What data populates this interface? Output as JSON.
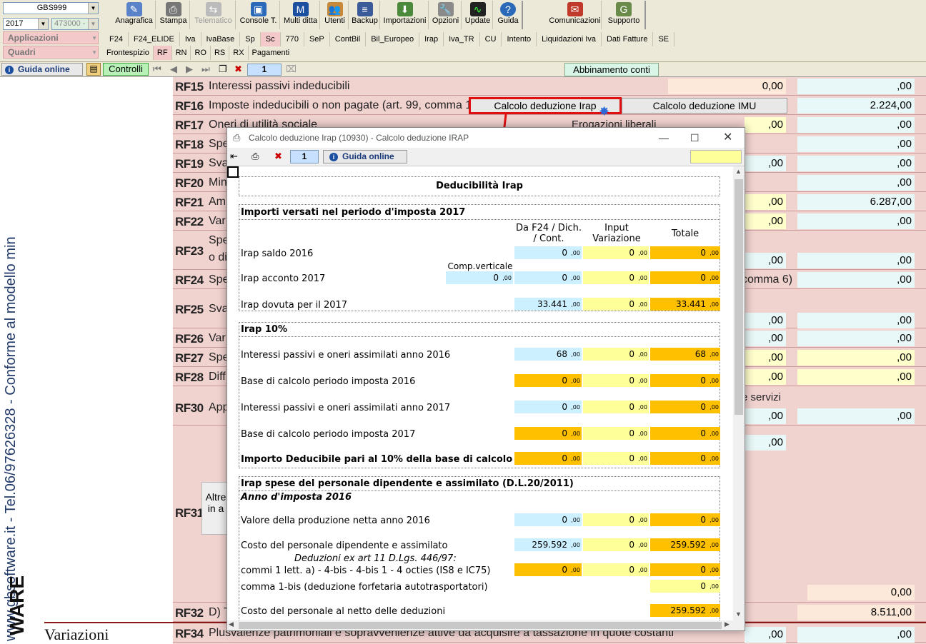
{
  "toolbar": {
    "company": "GBS999",
    "year": "2017",
    "code": "473000 -",
    "applicazioni": "Applicazioni",
    "quadri": "Quadri",
    "buttons": [
      "Anagrafica",
      "Stampa",
      "Telematico",
      "Console T.",
      "Multi ditta",
      "Utenti",
      "Backup",
      "Importazioni",
      "Opzioni",
      "Update",
      "Guida",
      "Comunicazioni",
      "Supporto"
    ],
    "tabs1": [
      "F24",
      "F24_ELIDE",
      "Iva",
      "IvaBase",
      "Sp",
      "Sc",
      "770",
      "SeP",
      "ContBil",
      "Bil_Europeo",
      "Irap",
      "Iva_TR",
      "CU",
      "Intento",
      "Liquidazioni Iva",
      "Dati Fatture",
      "SE"
    ],
    "tabs2": [
      "Frontespizio",
      "RF",
      "RN",
      "RO",
      "RS",
      "RX",
      "Pagamenti"
    ]
  },
  "nav": {
    "guida": "Guida online",
    "controlli": "Controlli",
    "page": "1",
    "abbinamento": "Abbinamento conti"
  },
  "banner": {
    "text": "www.gbsoftware.it - Tel.06/97626328 - Conforme al modello min",
    "ware": "WARE"
  },
  "form": {
    "rows": [
      {
        "code": "RF15",
        "desc": "Interessi passivi indeducibili",
        "v1": "0,00",
        "v2": ",00"
      },
      {
        "code": "RF16",
        "desc": "Imposte indeducibili o non pagate (art. 99, comma 1)",
        "v2": "2.224,00"
      },
      {
        "code": "RF17",
        "desc": "Oneri di utilità sociale",
        "v1": ",00",
        "v2": ",00"
      },
      {
        "code": "RF18",
        "desc": "Spe",
        "v2": ",00"
      },
      {
        "code": "RF19",
        "desc": "Sva",
        "v1": ",00",
        "v2": ",00"
      },
      {
        "code": "RF20",
        "desc": "Min",
        "v2": ",00"
      },
      {
        "code": "RF21",
        "desc": "Am",
        "v1": ",00",
        "v2": "6.287,00"
      },
      {
        "code": "RF22",
        "desc": "Var",
        "v1": ",00",
        "v2": ",00"
      },
      {
        "code": "RF23",
        "desc": "Spe",
        "v1": ",00",
        "v2": ",00"
      },
      {
        "code": "RF24",
        "desc": "Spe",
        "v2": ",00"
      },
      {
        "code": "RF25",
        "desc": "Sva",
        "v1": ",00",
        "v2": ",00"
      },
      {
        "code": "RF26",
        "desc": "Var",
        "v1": ",00",
        "v2": ",00"
      },
      {
        "code": "RF27",
        "desc": "Spe",
        "v1": ",00",
        "v2": ",00"
      },
      {
        "code": "RF28",
        "desc": "Diff",
        "v1": ",00",
        "v2": ",00"
      },
      {
        "code": "RF30",
        "desc": "App",
        "v1": ",00",
        "v2": ",00"
      },
      {
        "code": "RF31",
        "desc": "",
        "v1": ",00",
        "v2": ""
      },
      {
        "code": "RF32",
        "desc": "D) T",
        "v1": ",00",
        "v2": "8.511,00"
      },
      {
        "code": "RF34",
        "desc": "Plusvalenze patrimoniali e sopravvenienze attive da acquisire a tassazione in quote costanti",
        "v1": ",00",
        "v2": ",00"
      }
    ],
    "erogazioni": "Erogazioni liberali",
    "rf23b": "o di",
    "comma6": "comma 6)",
    "servizi": "e servizi",
    "altre": "Altre",
    "ina": "in a",
    "v55": "0,00",
    "variazioni": "Variazioni"
  },
  "buttons": {
    "irap": "Calcolo deduzione Irap",
    "imu": "Calcolo deduzione IMU"
  },
  "dialog": {
    "title": "Calcolo deduzione Irap (10930) - Calcolo deduzione IRAP",
    "page": "1",
    "guida": "Guida online",
    "heading": "Deducibilità Irap",
    "s1": {
      "title": "Importi versati nel periodo d'imposta 2017",
      "h1": "Da F24 / Dich. / Cont.",
      "h2": "Input Variazione",
      "h3": "Totale",
      "compvert": "Comp.verticale",
      "rows": [
        {
          "label": "Irap saldo 2016",
          "a": "0",
          "b": "0",
          "c": "0"
        },
        {
          "label": "Irap acconto 2017",
          "comp": "0",
          "a": "0",
          "b": "0",
          "c": "0"
        },
        {
          "label": "Irap dovuta per il 2017",
          "a": "33.441",
          "b": "0",
          "c": "33.441"
        }
      ]
    },
    "s2": {
      "title": "Irap 10%",
      "rows": [
        {
          "label": "Interessi passivi e oneri assimilati anno 2016",
          "a": "68",
          "b": "0",
          "c": "68"
        },
        {
          "label": "Base di calcolo periodo imposta 2016",
          "a": "0",
          "b": "0",
          "c": "0"
        },
        {
          "label": "Interessi passivi e oneri assimilati anno 2017",
          "a": "0",
          "b": "0",
          "c": "0"
        },
        {
          "label": "Base di calcolo periodo imposta 2017",
          "a": "0",
          "b": "0",
          "c": "0"
        },
        {
          "label": "Importo Deducibile pari al 10% della base di calcolo",
          "a": "0",
          "b": "0",
          "c": "0"
        }
      ]
    },
    "s3": {
      "title": "Irap spese del personale dipendente e assimilato (D.L.20/2011)",
      "sub": "Anno d'imposta 2016",
      "rows": [
        {
          "label": "Valore della produzione netta anno 2016",
          "a": "0",
          "b": "0",
          "c": "0"
        },
        {
          "label": "Costo del personale dipendente e assimilato",
          "a": "259.592",
          "b": "0",
          "c": "259.592"
        },
        {
          "label": "commi 1 lett. a) - 4-bis - 4-bis 1 - 4 octies (IS8 e IC75)",
          "a": "0",
          "b": "0",
          "c": "0"
        },
        {
          "label": "comma 1-bis (deduzione forfetaria autotrasportatori)",
          "c": "0"
        },
        {
          "label": "Costo del personale al netto delle deduzioni",
          "c": "259.592"
        }
      ],
      "deduz": "Deduzioni ex art 11 D.Lgs. 446/97:"
    },
    "dec": ",00"
  },
  "colors": {
    "pink": "#f0d2cf",
    "red": "#e01010",
    "cyan": "#ccf0ff",
    "yellow": "#ffff99",
    "orange": "#ffc000"
  }
}
